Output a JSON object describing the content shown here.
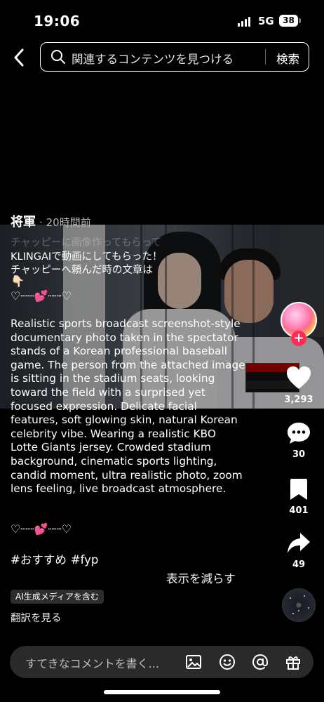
{
  "status_bar": {
    "time": "19:06",
    "network": "5G",
    "battery": "38"
  },
  "search": {
    "value": "関連するコンテンツを見つける",
    "button_label": "検索"
  },
  "post": {
    "author": "将軍",
    "time": "· 20時間前",
    "caption_ghost": "チャッピーに画像作ってもらって",
    "caption_line1": "KLINGAIで動画にしてもらった！",
    "caption_line2": "チャッピーへ頼んだ時の文章は",
    "pointing": "👇🏻",
    "hearts_left": "♡┈┈",
    "hearts_mid": "💕",
    "hearts_right": "┈┈♡",
    "prompt": "Realistic sports broadcast screenshot-style documentary photo taken in the spectator stands of a Korean professional baseball game. The person from the attached image is sitting in the stadium seats, looking toward the field with a surprised yet focused expression. Delicate facial features, soft glowing skin, natural Korean celebrity vibe. Wearing a realistic KBO Lotte Giants jersey. Crowded stadium background, cinematic sports lighting, candid moment, ultra realistic photo, zoom lens feeling, live broadcast atmosphere.",
    "hashtags": [
      "#おすすめ",
      "#fyp"
    ],
    "show_less": "表示を減らす",
    "ai_label": "AI生成メディアを含む",
    "translate": "翻訳を見る"
  },
  "actions": {
    "likes": "3,293",
    "comments": "30",
    "saves": "401",
    "shares": "49"
  },
  "comment_bar": {
    "placeholder": "すてきなコメントを書く..."
  },
  "colors": {
    "background": "#000000",
    "follow_red": "#fe2c55",
    "input_bg": "#2a2a2a",
    "heart_pink": "#ff4fb8"
  },
  "icons": [
    "back-icon",
    "search-icon",
    "heart-icon",
    "comment-icon",
    "bookmark-icon",
    "share-icon",
    "image-icon",
    "emoji-icon",
    "mention-icon",
    "gift-icon",
    "plus-icon",
    "music-disc-icon"
  ]
}
